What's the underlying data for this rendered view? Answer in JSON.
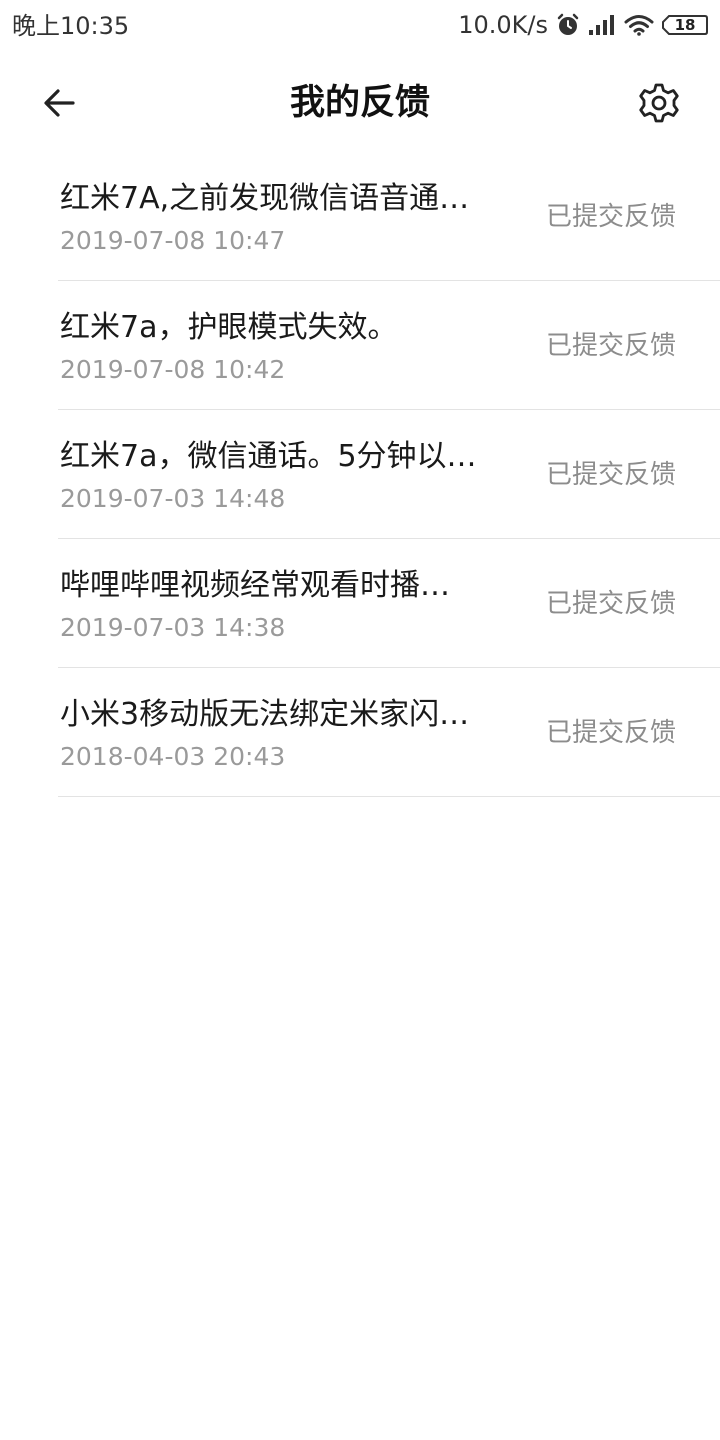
{
  "status_bar": {
    "time": "晚上10:35",
    "net_speed": "10.0K/s",
    "battery": "18",
    "icons": [
      "alarm-icon",
      "signal-icon",
      "wifi-icon",
      "battery-icon"
    ]
  },
  "header": {
    "title": "我的反馈",
    "back_icon": "back-arrow-icon",
    "settings_icon": "gear-icon"
  },
  "feedback": [
    {
      "title": "红米7A,之前发现微信语音通…",
      "date": "2019-07-08 10:47",
      "status": "已提交反馈"
    },
    {
      "title": "红米7a，护眼模式失效。",
      "date": "2019-07-08 10:42",
      "status": "已提交反馈"
    },
    {
      "title": "红米7a，微信通话。5分钟以…",
      "date": "2019-07-03 14:48",
      "status": "已提交反馈"
    },
    {
      "title": "哔哩哔哩视频经常观看时播…",
      "date": "2019-07-03 14:38",
      "status": "已提交反馈"
    },
    {
      "title": "小米3移动版无法绑定米家闪…",
      "date": "2018-04-03 20:43",
      "status": "已提交反馈"
    }
  ]
}
